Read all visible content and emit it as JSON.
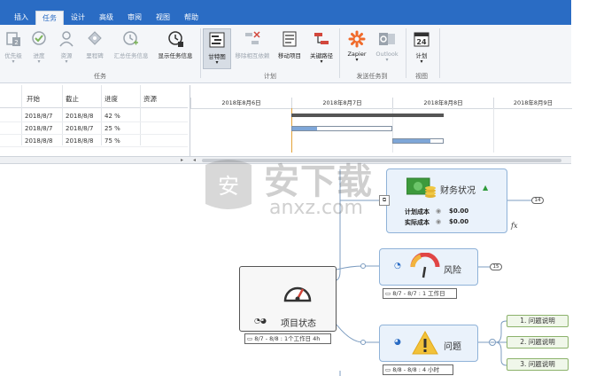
{
  "tabs": [
    "插入",
    "任务",
    "设计",
    "高级",
    "审阅",
    "视图",
    "帮助"
  ],
  "active_tab_index": 1,
  "ribbon": {
    "buttons": [
      {
        "label": "优先级",
        "icon": "priority-icon"
      },
      {
        "label": "进度",
        "icon": "progress-icon"
      },
      {
        "label": "资源",
        "icon": "resource-icon"
      },
      {
        "label": "里程碑",
        "icon": "milestone-icon"
      },
      {
        "label": "汇总任务信息",
        "icon": "summary-info-icon"
      },
      {
        "label": "显示任务信息",
        "icon": "show-task-info-icon"
      },
      {
        "label": "甘特图",
        "icon": "gantt-chart-icon"
      },
      {
        "label": "移除相互依赖",
        "icon": "remove-dependency-icon"
      },
      {
        "label": "移动项目",
        "icon": "move-project-icon"
      },
      {
        "label": "关键路径",
        "icon": "critical-path-icon"
      },
      {
        "label": "Zapier",
        "icon": "zapier-icon"
      },
      {
        "label": "Outlook",
        "icon": "outlook-icon"
      },
      {
        "label": "计划",
        "icon": "calendar-icon"
      }
    ],
    "groups": [
      "任务",
      "计划",
      "发送任务到",
      "视图"
    ]
  },
  "grid": {
    "headers": [
      "开始",
      "截止",
      "进度",
      "资源"
    ],
    "rows": [
      {
        "start": "2018/8/7",
        "end": "2018/8/8",
        "progress": "42 %"
      },
      {
        "start": "2018/8/7",
        "end": "2018/8/7",
        "progress": "25 %"
      },
      {
        "start": "2018/8/8",
        "end": "2018/8/8",
        "progress": "75 %"
      }
    ]
  },
  "gantt": {
    "dates": [
      "2018年8月6日",
      "2018年8月7日",
      "2018年8月8日",
      "2018年8月9日"
    ],
    "progress_fractions": [
      0.42,
      0.25,
      0.75
    ]
  },
  "mindmap": {
    "root": {
      "title": "项目状态",
      "info": "8/7 - 8/8 : 1个工作日 4h"
    },
    "finance": {
      "title": "财务状况",
      "planned_label": "计划成本",
      "planned_value": "$0.00",
      "actual_label": "实际成本",
      "actual_value": "$0.00",
      "badge": "14",
      "fx": "fx"
    },
    "risk": {
      "title": "风险",
      "info": "8/7 - 8/7 : 1 工作日",
      "badge": "15"
    },
    "issue": {
      "title": "问题",
      "info": "8/8 - 8/8 : 4 小时",
      "children": [
        "1. 问题说明",
        "2. 问题说明",
        "3. 问题说明"
      ]
    }
  },
  "watermark": {
    "cn": "安下载",
    "en": "anxz.com"
  },
  "colors": {
    "accent": "#2a6cc4",
    "node_fill": "#eaf2fb",
    "child_fill": "#f0f7ea"
  }
}
